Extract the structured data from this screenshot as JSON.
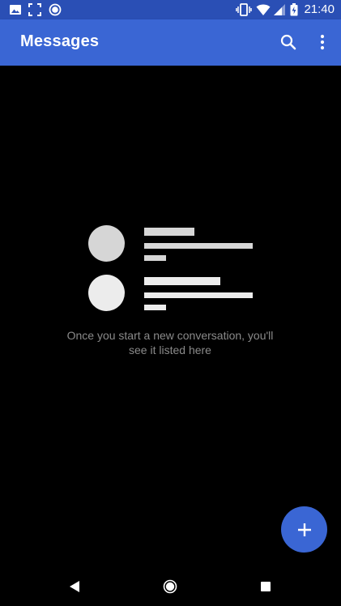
{
  "status_bar": {
    "time": "21:40",
    "left_icons": [
      "image-icon",
      "screenshot-icon",
      "record-icon"
    ],
    "right_icons": [
      "vibrate-icon",
      "wifi-icon",
      "signal-icon",
      "battery-icon"
    ],
    "color": "#2a4fb5"
  },
  "app_bar": {
    "title": "Messages",
    "actions": [
      "search-icon",
      "more-vert-icon"
    ],
    "color": "#3a66d4"
  },
  "empty_state": {
    "line1": "Once you start a new conversation, you'll",
    "line2": "see it listed here"
  },
  "fab": {
    "icon": "plus-icon",
    "color": "#3a66d4"
  },
  "nav_bar": {
    "buttons": [
      "back-icon",
      "home-icon",
      "recents-icon"
    ]
  }
}
